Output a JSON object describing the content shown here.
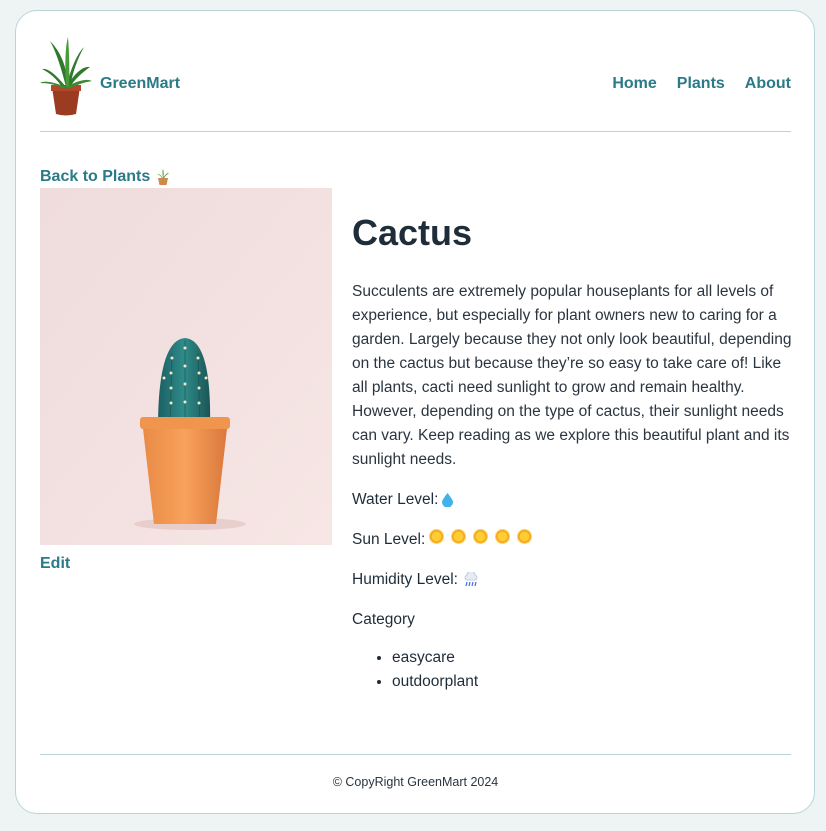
{
  "header": {
    "brand": "GreenMart",
    "nav": [
      {
        "label": "Home"
      },
      {
        "label": "Plants"
      },
      {
        "label": "About"
      }
    ]
  },
  "back_link": "Back to Plants",
  "edit_link": "Edit",
  "plant": {
    "name": "Cactus",
    "description": "Succulents are extremely popular houseplants for all levels of experience, but especially for plant owners new to caring for a garden. Largely because they not only look beautiful, depending on the cactus but because they’re so easy to take care of! Like all plants, cacti need sunlight to grow and remain healthy. However, depending on the type of cactus, their sunlight needs can vary. Keep reading as we explore this beautiful plant and its sunlight needs.",
    "water_label": "Water Level:",
    "water_level": 1,
    "sun_label": "Sun Level:",
    "sun_level": 5,
    "humidity_label": "Humidity Level:",
    "humidity_level": 1,
    "category_label": "Category",
    "categories": [
      "easycare",
      "outdoorplant"
    ]
  },
  "footer": "© CopyRight GreenMart 2024",
  "colors": {
    "accent": "#2b7a87",
    "border": "#b9d4d8",
    "background": "#eef4f3"
  }
}
